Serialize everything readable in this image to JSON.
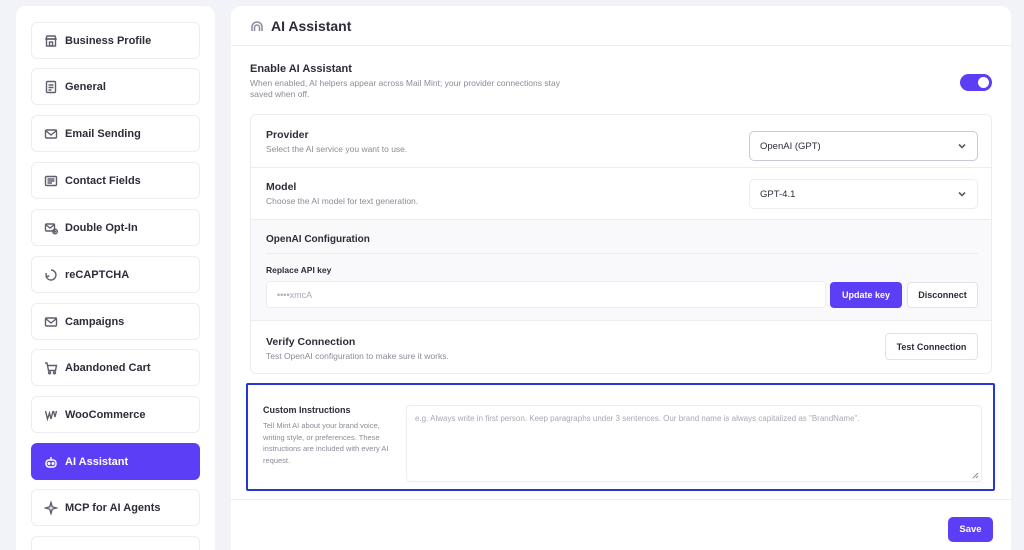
{
  "sidebar": {
    "items": [
      {
        "label": "Business Profile",
        "icon": "storefront-icon"
      },
      {
        "label": "General",
        "icon": "document-icon"
      },
      {
        "label": "Email Sending",
        "icon": "envelope-icon"
      },
      {
        "label": "Contact Fields",
        "icon": "contact-card-icon"
      },
      {
        "label": "Double Opt-In",
        "icon": "mail-check-icon"
      },
      {
        "label": "reCAPTCHA",
        "icon": "recaptcha-icon"
      },
      {
        "label": "Campaigns",
        "icon": "envelope-icon"
      },
      {
        "label": "Abandoned Cart",
        "icon": "cart-icon"
      },
      {
        "label": "WooCommerce",
        "icon": "woocommerce-icon"
      },
      {
        "label": "AI Assistant",
        "icon": "ai-robot-icon",
        "active": true
      },
      {
        "label": "MCP for AI Agents",
        "icon": "sparkle-icon"
      }
    ]
  },
  "header": {
    "title": "AI Assistant",
    "icon": "ai-arc-icon"
  },
  "enable": {
    "title": "Enable AI Assistant",
    "description": "When enabled, AI helpers appear across Mail Mint; your provider connections stay saved when off.",
    "enabled": true
  },
  "provider": {
    "title": "Provider",
    "description": "Select the AI service you want to use.",
    "value": "OpenAI (GPT)"
  },
  "model": {
    "title": "Model",
    "description": "Choose the AI model for text generation.",
    "value": "GPT-4.1"
  },
  "config": {
    "title": "OpenAI Configuration",
    "api_label": "Replace API key",
    "api_placeholder": "••••xmcA",
    "update_label": "Update key",
    "disconnect_label": "Disconnect"
  },
  "verify": {
    "title": "Verify Connection",
    "description": "Test OpenAI configuration to make sure it works.",
    "button_label": "Test Connection"
  },
  "custom": {
    "title": "Custom Instructions",
    "description": "Tell Mint AI about your brand voice, writing style, or preferences. These instructions are included with every AI request.",
    "placeholder": "e.g. Always write in first person. Keep paragraphs under 3 sentences. Our brand name is always capitalized as \"BrandName\"."
  },
  "footer": {
    "save_label": "Save"
  },
  "colors": {
    "accent": "#5b3ef6",
    "highlight_border": "#2436d4"
  }
}
